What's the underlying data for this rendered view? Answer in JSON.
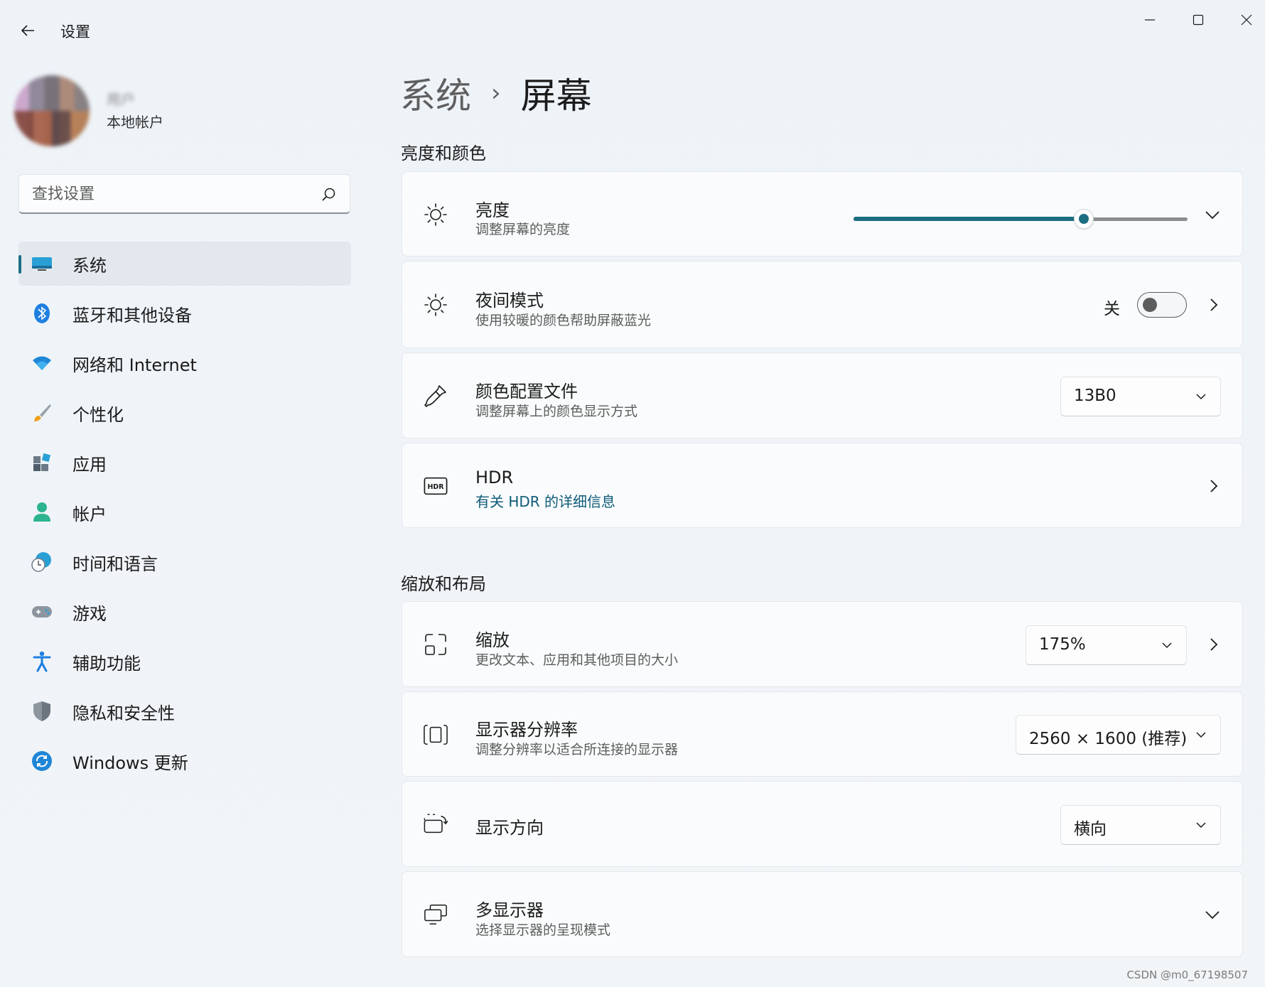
{
  "window": {
    "app_title": "设置"
  },
  "profile": {
    "name": "用户",
    "account_type": "本地帐户"
  },
  "search": {
    "placeholder": "查找设置"
  },
  "nav": {
    "items": [
      {
        "label": "系统",
        "icon": "system-icon",
        "active": true
      },
      {
        "label": "蓝牙和其他设备",
        "icon": "bluetooth-icon"
      },
      {
        "label": "网络和 Internet",
        "icon": "wifi-icon"
      },
      {
        "label": "个性化",
        "icon": "brush-icon"
      },
      {
        "label": "应用",
        "icon": "apps-icon"
      },
      {
        "label": "帐户",
        "icon": "account-icon"
      },
      {
        "label": "时间和语言",
        "icon": "globe-clock-icon"
      },
      {
        "label": "游戏",
        "icon": "gamepad-icon"
      },
      {
        "label": "辅助功能",
        "icon": "accessibility-icon"
      },
      {
        "label": "隐私和安全性",
        "icon": "shield-icon"
      },
      {
        "label": "Windows 更新",
        "icon": "update-icon"
      }
    ]
  },
  "breadcrumb": {
    "parent": "系统",
    "separator": "›",
    "current": "屏幕"
  },
  "sections": {
    "brightness_color": {
      "title": "亮度和颜色",
      "brightness": {
        "title": "亮度",
        "subtitle": "调整屏幕的亮度",
        "value_percent": 69
      },
      "night_light": {
        "title": "夜间模式",
        "subtitle": "使用较暖的颜色帮助屏蔽蓝光",
        "state_label": "关",
        "on": false
      },
      "color_profile": {
        "title": "颜色配置文件",
        "subtitle": "调整屏幕上的颜色显示方式",
        "selected": "13B0"
      },
      "hdr": {
        "title": "HDR",
        "link": "有关 HDR 的详细信息"
      }
    },
    "scale_layout": {
      "title": "缩放和布局",
      "scale": {
        "title": "缩放",
        "subtitle": "更改文本、应用和其他项目的大小",
        "selected": "175%"
      },
      "resolution": {
        "title": "显示器分辨率",
        "subtitle": "调整分辨率以适合所连接的显示器",
        "selected": "2560 × 1600 (推荐)"
      },
      "orientation": {
        "title": "显示方向",
        "selected": "横向"
      },
      "multi_display": {
        "title": "多显示器",
        "subtitle": "选择显示器的呈现模式"
      }
    }
  },
  "watermark": "CSDN @m0_67198507",
  "colors": {
    "accent": "#1d6e80",
    "link": "#0f5b78",
    "background": "#eef3f8"
  }
}
